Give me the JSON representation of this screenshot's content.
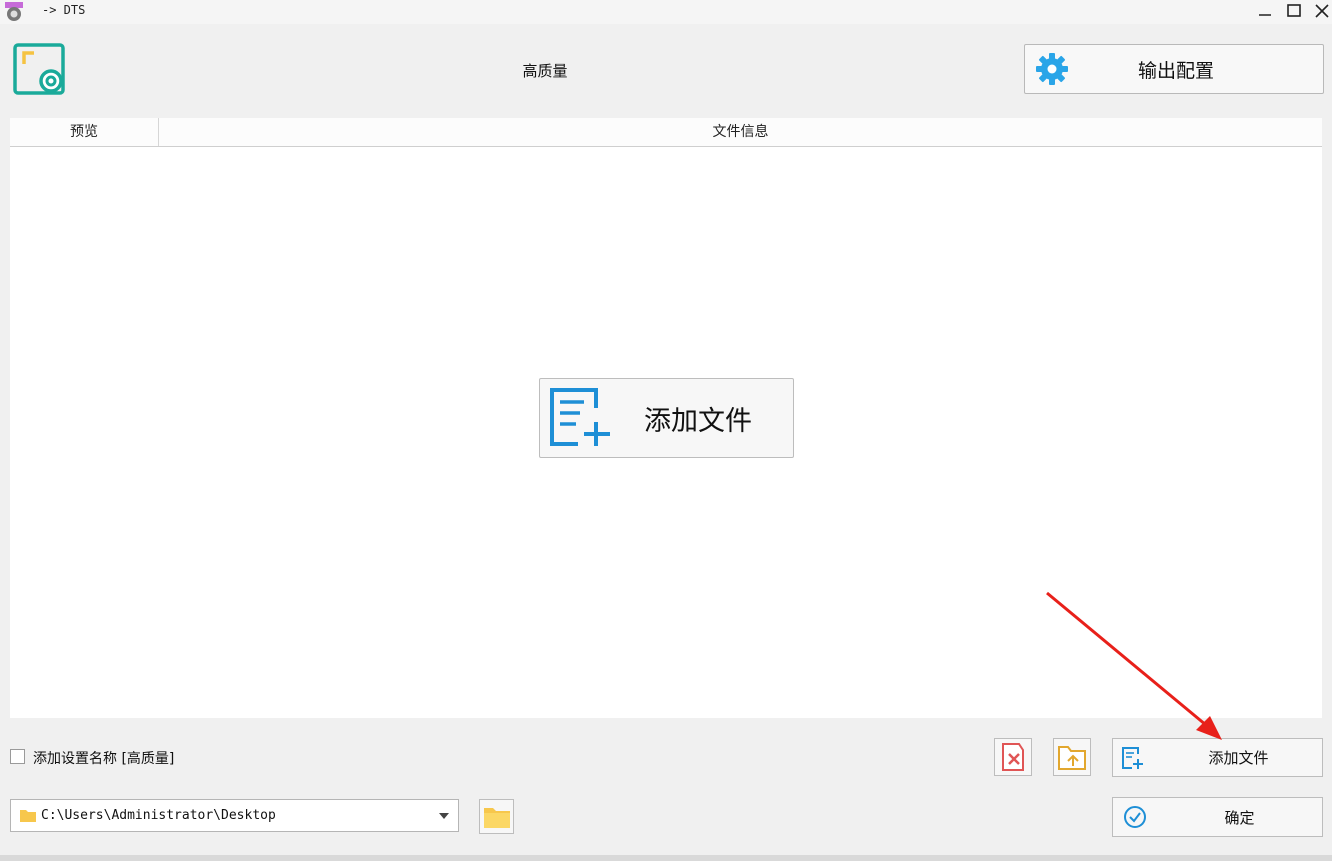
{
  "window": {
    "title": "-> DTS",
    "controls": [
      "minimize-icon",
      "maximize-icon",
      "close-icon"
    ]
  },
  "header": {
    "preset_name": "高质量",
    "output_config_label": "输出配置",
    "logo_icon": "video-settings-logo-icon",
    "gear_icon": "gear-icon"
  },
  "table": {
    "columns": [
      "预览",
      "文件信息"
    ],
    "rows": []
  },
  "main": {
    "add_file_big_label": "添加文件",
    "add_file_icon": "add-file-icon"
  },
  "bottom": {
    "checkbox_label": "添加设置名称 [高质量]",
    "checkbox_checked": false,
    "add_file_label": "添加文件",
    "confirm_label": "确定",
    "output_path": "C:\\Users\\Administrator\\Desktop"
  },
  "colors": {
    "accent_blue": "#1e8fd6",
    "logo_teal": "#1aaa9a",
    "logo_yellow": "#f5c342",
    "folder_yellow": "#f7c74c",
    "clear_red": "#e05555",
    "annotation_red": "#e8201a"
  }
}
